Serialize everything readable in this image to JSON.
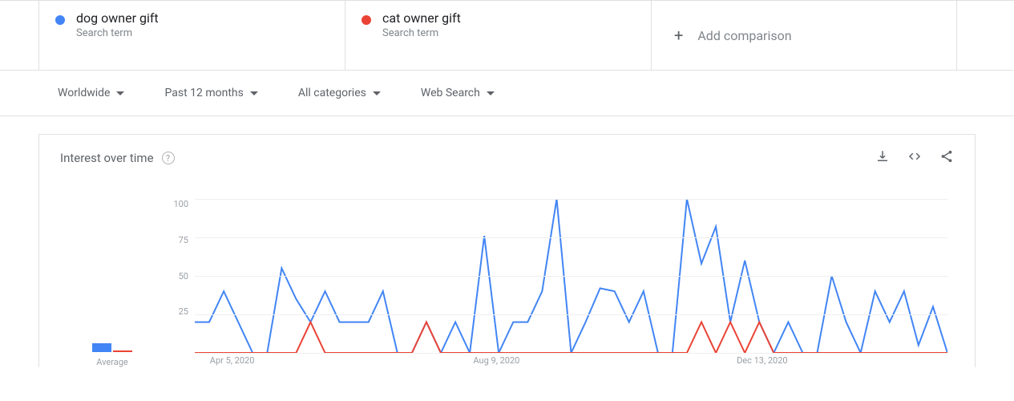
{
  "comparisons": [
    {
      "term": "dog owner gift",
      "subtitle": "Search term",
      "color": "#4285f4"
    },
    {
      "term": "cat owner gift",
      "subtitle": "Search term",
      "color": "#ea4335"
    }
  ],
  "add_comparison_label": "Add comparison",
  "filters": {
    "geo": "Worldwide",
    "time": "Past 12 months",
    "category": "All categories",
    "property": "Web Search"
  },
  "card": {
    "title": "Interest over time"
  },
  "y_ticks": [
    "100",
    "75",
    "50",
    "25"
  ],
  "x_ticks": [
    {
      "label": "Apr 5, 2020",
      "pos": 0.02
    },
    {
      "label": "Aug 9, 2020",
      "pos": 0.37
    },
    {
      "label": "Dec 13, 2020",
      "pos": 0.72
    }
  ],
  "avg_label": "Average",
  "chart_data": {
    "type": "line",
    "title": "Interest over time",
    "ylabel": "",
    "xlabel": "",
    "ylim": [
      0,
      100
    ],
    "averages": {
      "dog owner gift": 22,
      "cat owner gift": 2
    },
    "series": [
      {
        "name": "dog owner gift",
        "color": "#4285f4",
        "values": [
          20,
          20,
          40,
          20,
          0,
          0,
          55,
          35,
          20,
          40,
          20,
          20,
          20,
          40,
          0,
          0,
          20,
          0,
          20,
          0,
          76,
          0,
          20,
          20,
          40,
          100,
          0,
          20,
          42,
          40,
          20,
          40,
          0,
          0,
          100,
          58,
          82,
          20,
          60,
          20,
          0,
          20,
          0,
          0,
          50,
          20,
          0,
          40,
          20,
          40,
          5,
          30,
          0
        ]
      },
      {
        "name": "cat owner gift",
        "color": "#ea4335",
        "values": [
          0,
          0,
          0,
          0,
          0,
          0,
          0,
          0,
          20,
          0,
          0,
          0,
          0,
          0,
          0,
          0,
          20,
          0,
          0,
          0,
          0,
          0,
          0,
          0,
          0,
          0,
          0,
          0,
          0,
          0,
          0,
          0,
          0,
          0,
          0,
          20,
          0,
          20,
          0,
          20,
          0,
          0,
          0,
          0,
          0,
          0,
          0,
          0,
          0,
          0,
          0,
          0,
          0
        ]
      }
    ]
  }
}
